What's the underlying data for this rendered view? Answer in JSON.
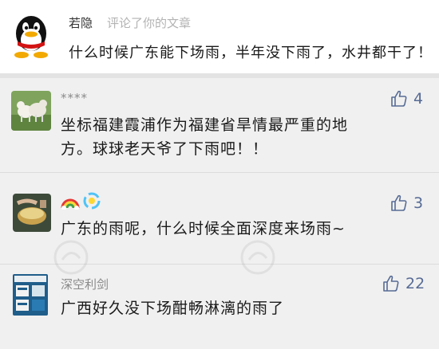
{
  "post": {
    "author": "若隐",
    "action": "评论了你的文章",
    "text": "什么时候广东能下场雨，半年没下雨了，水井都干了！"
  },
  "comments": [
    {
      "author": "****",
      "text_line1": "坐标福建霞浦作为福建省旱情最严重的地",
      "text_line2": "方。球球老天爷了下雨吧！！",
      "likes": "4"
    },
    {
      "author": "",
      "text": "广东的雨呢，什么时候全面深度来场雨~",
      "likes": "3"
    },
    {
      "author": "深空利剑",
      "text": "广西好久没下场酣畅淋漓的雨了",
      "likes": "22"
    }
  ],
  "icons": {
    "like": "thumbs-up-icon",
    "rainbow": "rainbow-icon",
    "swirl": "swirl-icon"
  },
  "colors": {
    "like_blue": "#576b95",
    "name_gray": "#8a8a8a",
    "text": "#1a1a1a",
    "row_bg": "#f0f0f0"
  }
}
